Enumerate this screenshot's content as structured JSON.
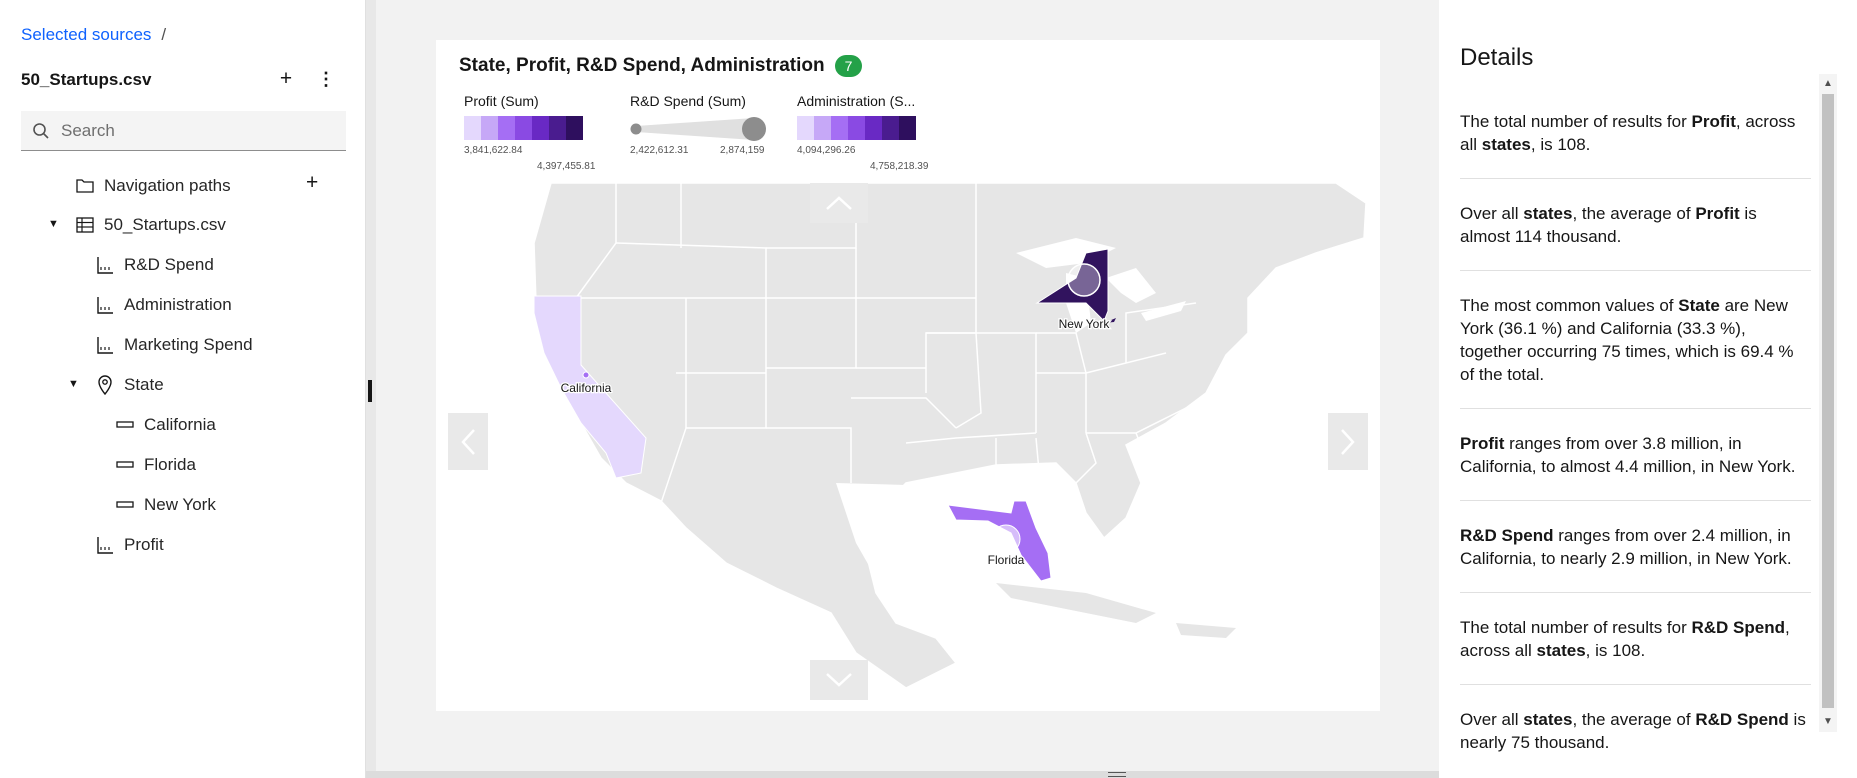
{
  "sidebar": {
    "breadcrumb_link": "Selected sources",
    "breadcrumb_sep": "/",
    "source_title": "50_Startups.csv",
    "add_label": "+",
    "more_label": "⋮",
    "search_placeholder": "Search",
    "tree": {
      "navigation_paths": "Navigation paths",
      "nav_add": "+",
      "dataset": "50_Startups.csv",
      "rd_spend": "R&D Spend",
      "administration": "Administration",
      "marketing_spend": "Marketing Spend",
      "state": "State",
      "california": "California",
      "florida": "Florida",
      "new_york": "New York",
      "profit": "Profit"
    }
  },
  "viz": {
    "title": "State, Profit, R&D Spend, Administration",
    "badge": "7",
    "legend": {
      "profit_label": "Profit (Sum)",
      "profit_min": "3,841,622.84",
      "profit_max": "4,397,455.81",
      "rd_label": "R&D Spend (Sum)",
      "rd_min": "2,422,612.31",
      "rd_max": "2,874,159",
      "admin_label": "Administration (S...",
      "admin_min": "4,094,296.26",
      "admin_max": "4,758,218.39",
      "colors": [
        "#e4d8fd",
        "#c6a8f7",
        "#a56ef4",
        "#8a4ae3",
        "#6929c4",
        "#4a1c8f",
        "#2e0f5e"
      ]
    },
    "map_labels": {
      "california": "California",
      "florida": "Florida",
      "new_york": "New York"
    },
    "state_colors": {
      "california": "#e4d8fd",
      "florida": "#a56ef4",
      "new_york": "#31135e",
      "base": "#e6e6e6",
      "water": "#ffffff"
    }
  },
  "details": {
    "title": "Details",
    "items": [
      {
        "a": "The total number of results for ",
        "b": "Profit",
        "c": ", across all ",
        "d": "states",
        "e": ", is 108."
      },
      {
        "a": "Over all ",
        "b": "states",
        "c": ", the average of ",
        "d": "Profit",
        "e": " is almost 114 thousand."
      },
      {
        "a": "The most common values of ",
        "b": "State",
        "c": " are New York (36.1 %) and California (33.3 %), together occurring 75 times, which is 69.4 % of the total.",
        "d": "",
        "e": ""
      },
      {
        "a": "",
        "b": "Profit",
        "c": " ranges from over 3.8 million, in California, to almost 4.4 million, in New York.",
        "d": "",
        "e": ""
      },
      {
        "a": "",
        "b": "R&D Spend",
        "c": " ranges from over 2.4 million, in California, to nearly 2.9 million, in New York.",
        "d": "",
        "e": ""
      },
      {
        "a": "The total number of results for ",
        "b": "R&D Spend",
        "c": ", across all ",
        "d": "states",
        "e": ", is 108."
      },
      {
        "a": "Over all ",
        "b": "states",
        "c": ", the average of ",
        "d": "R&D Spend",
        "e": " is nearly 75 thousand."
      }
    ]
  }
}
